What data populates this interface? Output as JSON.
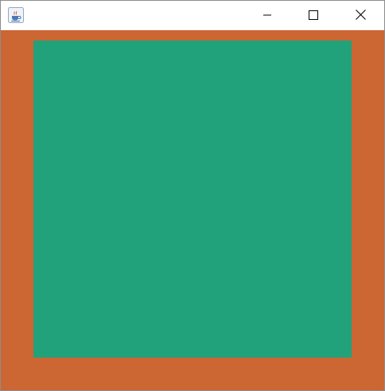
{
  "window": {
    "title": "",
    "icon": "java-coffee-cup-icon",
    "controls": {
      "minimize": "minimize-icon",
      "maximize": "maximize-icon",
      "close": "close-icon"
    }
  },
  "canvas": {
    "background_color": "#cc6633",
    "square_color": "#22a27b"
  }
}
